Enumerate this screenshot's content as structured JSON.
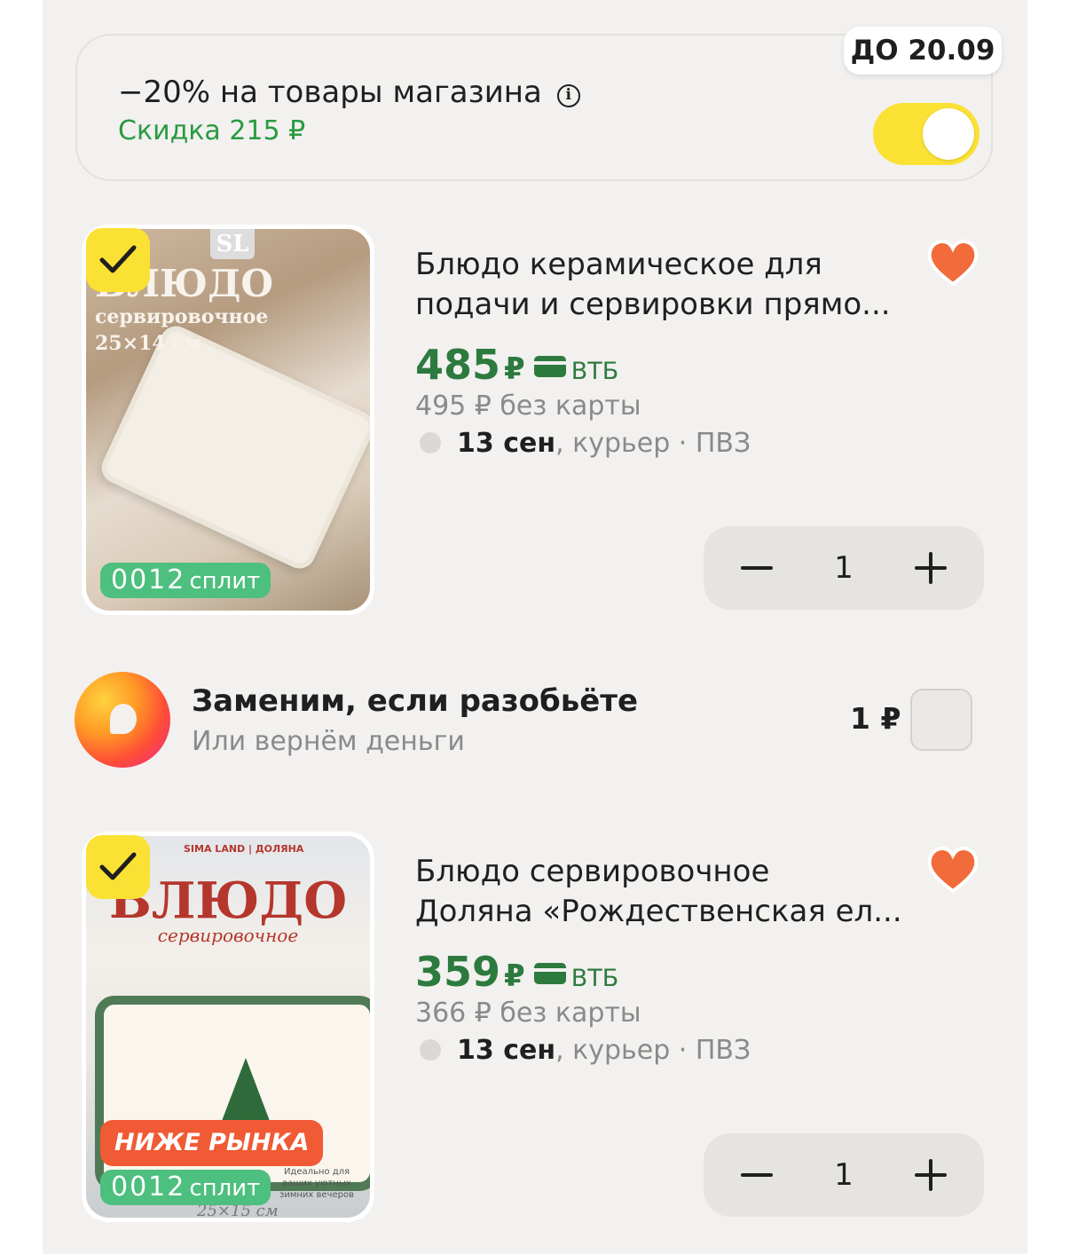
{
  "promo": {
    "title": "−20% на товары магазина",
    "discount": "Скидка 215 ₽",
    "deadline": "ДО 20.09",
    "toggle_on": true
  },
  "products": [
    {
      "title_line1": "Блюдо керамическое для",
      "title_line2": "подачи и сервировки прямо...",
      "price": "485",
      "currency": "₽",
      "bank": "ВТБ",
      "old_price": "495 ₽  без карты",
      "delivery_date": "13 сен",
      "delivery_rest": ", курьер · ПВЗ",
      "quantity": "1",
      "split_digits": "0012",
      "split_label": "сплит",
      "image": {
        "brand": "SL",
        "headline": "БЛЮДО",
        "subtitle": "сервировочное",
        "size": "25×14 см"
      },
      "selected": true,
      "favorite": true
    },
    {
      "title_line1": "Блюдо сервировочное",
      "title_line2": "Доляна «Рождественская ел...",
      "price": "359",
      "currency": "₽",
      "bank": "ВТБ",
      "old_price": "366 ₽  без карты",
      "delivery_date": "13 сен",
      "delivery_rest": ", курьер · ПВЗ",
      "quantity": "1",
      "split_digits": "0012",
      "split_label": "сплит",
      "badge": "НИЖЕ РЫНКА",
      "image": {
        "brand": "SIMA LAND | ДОЛЯНА",
        "headline": "БЛЮДО",
        "subtitle": "сервировочное",
        "footer": "Идеально для ваших уютных зимних вечеров",
        "size": "25×15 см"
      },
      "selected": true,
      "favorite": true
    }
  ],
  "insurance": {
    "title": "Заменим, если разобьёте",
    "subtitle": "Или вернём деньги",
    "price": "1 ₽",
    "checked": false
  },
  "colors": {
    "accent_yellow": "#fbe134",
    "price_green": "#2d7a3e",
    "discount_green": "#2a9a41",
    "heart": "#f26b3a",
    "split_green": "#4dbf7e",
    "badge_red": "#f05a34"
  },
  "icons": {
    "info": "info-icon",
    "heart": "heart-icon",
    "check": "check-icon",
    "card": "bank-card-icon",
    "minus": "minus-icon",
    "plus": "plus-icon"
  }
}
